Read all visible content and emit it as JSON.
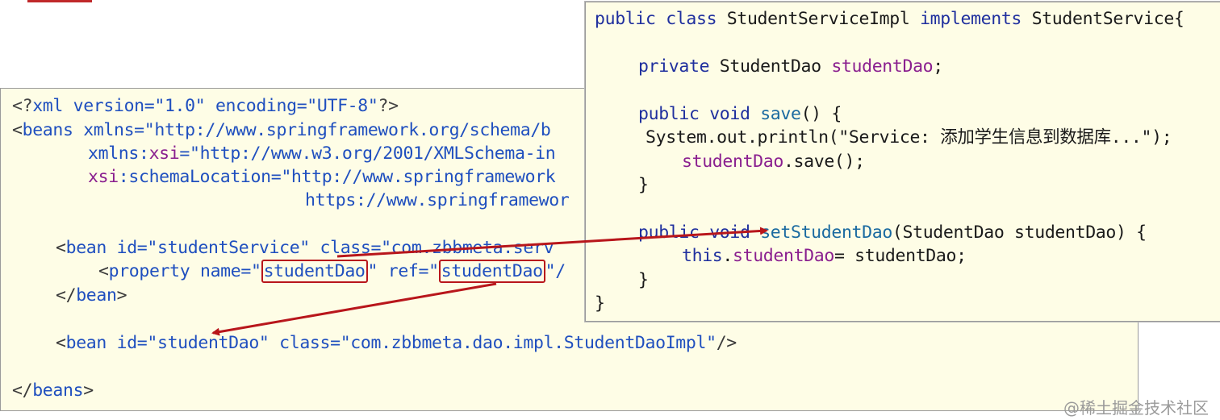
{
  "xml": {
    "l1": {
      "a": "<?",
      "b": "xml",
      "c": " version=",
      "d": "\"1.0\"",
      "e": " encoding=",
      "f": "\"UTF-8\"",
      "g": "?>"
    },
    "l2": {
      "a": "<",
      "b": "beans",
      "c": " xmlns=",
      "d": "\"http://www.springframework.org/schema/b"
    },
    "l3": {
      "a": "xmlns:",
      "b": "xsi",
      "c": "=",
      "d": "\"http://www.w3.org/2001/XMLSchema-in"
    },
    "l4": {
      "a": "xsi",
      "b": ":schemaLocation=",
      "c": "\"http://www.springframework"
    },
    "l5": {
      "a": "https://www.springframewor"
    },
    "l6": {
      "a": "<",
      "b": "bean",
      "c": " id=",
      "d": "\"studentService\"",
      "e": " class=",
      "f": "\"com.zbbmeta.serv"
    },
    "l7": {
      "a": "<",
      "b": "property",
      "c": " name=",
      "d": "\"",
      "e": "studentDao",
      "f": "\"",
      "g": " ref=",
      "h": "\"",
      "i": "studentDao",
      "j": "\"/"
    },
    "l8": {
      "a": "</",
      "b": "bean",
      "c": ">"
    },
    "l9": {
      "a": "<",
      "b": "bean",
      "c": " id=",
      "d": "\"studentDao\"",
      "e": " class=",
      "f": "\"com.zbbmeta.dao.impl.StudentDaoImpl\"",
      "g": "/>"
    },
    "l10": {
      "a": "</",
      "b": "beans",
      "c": ">"
    }
  },
  "java": {
    "l1": {
      "a": "public",
      "b": " ",
      "c": "class",
      "d": " StudentServiceImpl ",
      "e": "implements",
      "f": " StudentService{"
    },
    "l2": {
      "a": "private",
      "b": " StudentDao ",
      "c": "studentDao",
      "d": ";"
    },
    "l3": {
      "a": "public",
      "b": " ",
      "c": "void",
      "d": " ",
      "e": "save",
      "f": "() {"
    },
    "l4": {
      "a": "System.out.println(\"Service: 添加学生信息到数据库...\");"
    },
    "l5": {
      "a": "studentDao",
      "b": ".save();"
    },
    "l6": {
      "a": "}"
    },
    "l7": {
      "a": "public",
      "b": " ",
      "c": "void",
      "d": " ",
      "e": "setStudentDao",
      "f": "(StudentDao studentDao) {"
    },
    "l8": {
      "a": "this",
      "b": ".",
      "c": "studentDao",
      "d": "= studentDao;"
    },
    "l9": {
      "a": "}"
    },
    "l10": {
      "a": "}"
    }
  },
  "watermark": "@稀土掘金技术社区",
  "colors": {
    "highlight": "#b8161b",
    "panel": "#fefde6",
    "keyword": "#1f2f9e",
    "field": "#8a1f8f"
  }
}
